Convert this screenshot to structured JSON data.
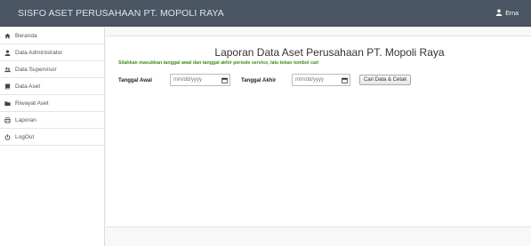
{
  "header": {
    "brand": "SISFO ASET PERUSAHAAN PT. MOPOLI RAYA",
    "user_name": "Erna"
  },
  "sidebar": {
    "items": [
      {
        "label": "Beranda",
        "icon": "home-icon"
      },
      {
        "label": "Data Administrator",
        "icon": "user-icon"
      },
      {
        "label": "Data Supervisor",
        "icon": "users-icon"
      },
      {
        "label": "Data Aset",
        "icon": "book-icon"
      },
      {
        "label": "Riwayat Aset",
        "icon": "folder-icon"
      },
      {
        "label": "Laporan",
        "icon": "print-icon"
      },
      {
        "label": "LogOut",
        "icon": "power-icon"
      }
    ]
  },
  "main": {
    "title": "Laporan Data Aset Perusahaan PT. Mopoli Raya",
    "instruction": "Silahkan masukkan tanggal awal dan tanggal akhir periode service, lalu tekan tombol cari",
    "start_label": "Tanggal Awal",
    "start_placeholder": "mm/dd/yyyy",
    "end_label": "Tanggal Akhir",
    "end_placeholder": "mm/dd/yyyy",
    "button_label": "Cari Data & Cetak"
  },
  "colors": {
    "topbar": "#4a5664",
    "instruction_text": "#3c8d1c",
    "sidebar_bg": "#ffffff",
    "page_bg": "#f8f8f8"
  }
}
